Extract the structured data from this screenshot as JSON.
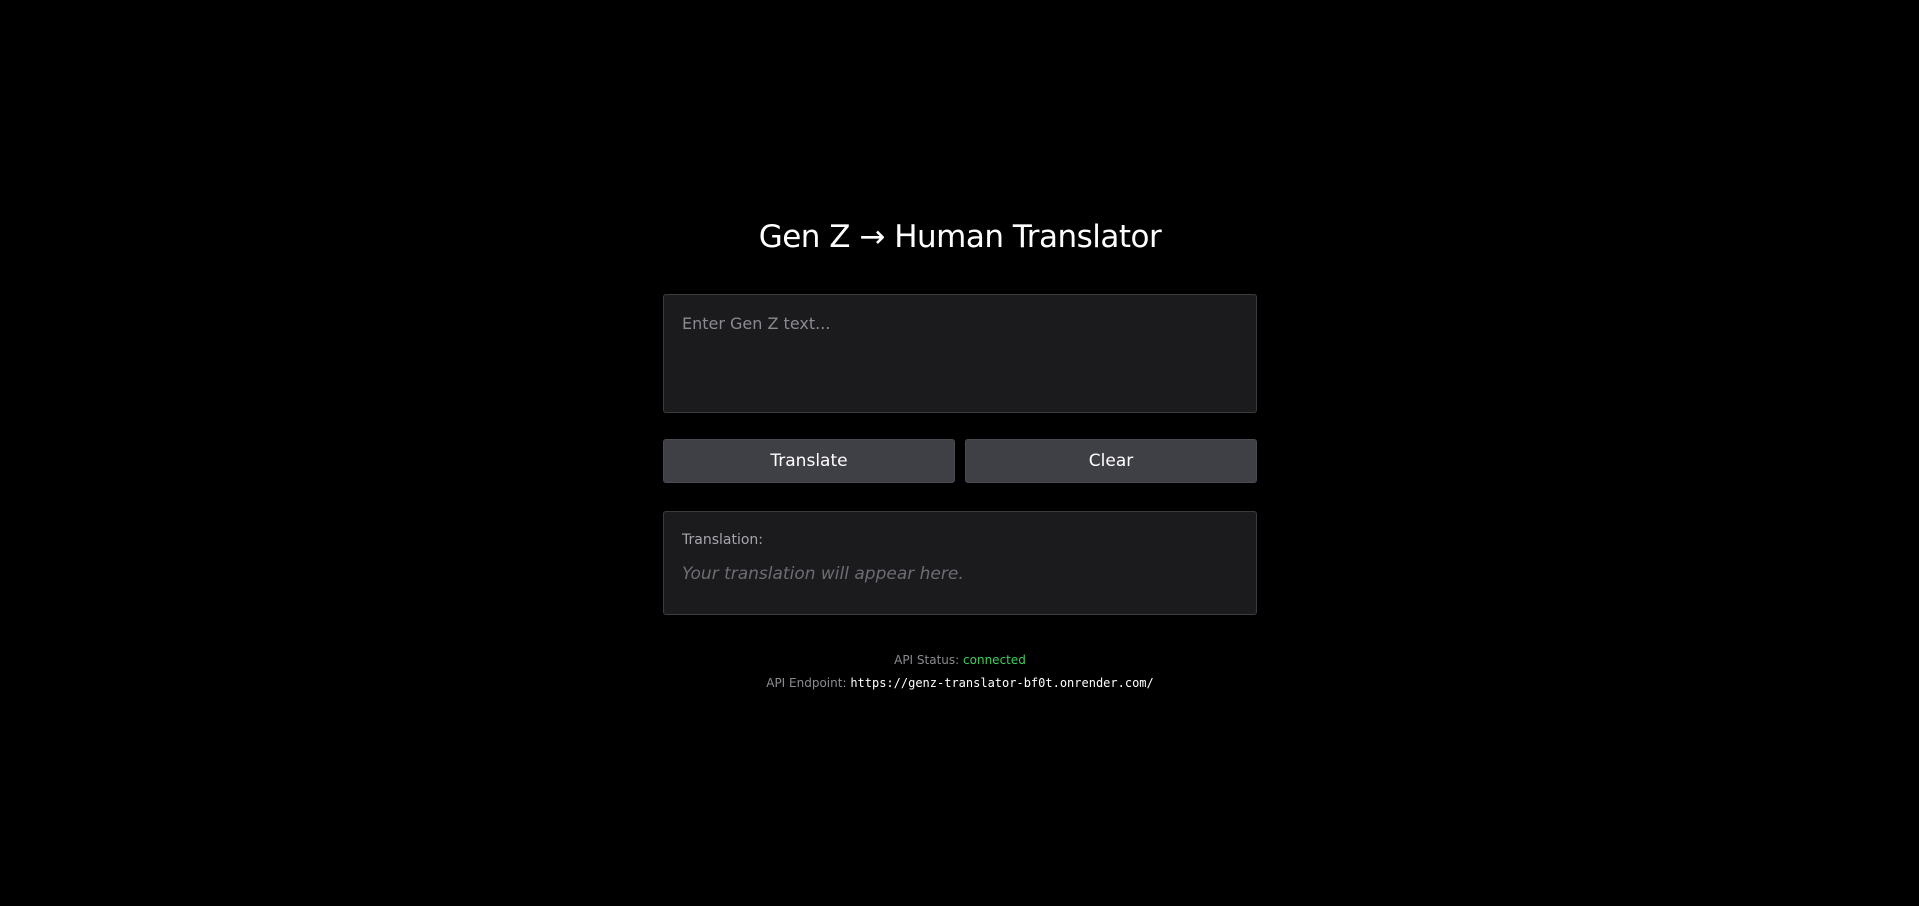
{
  "title": "Gen Z → Human Translator",
  "input": {
    "placeholder": "Enter Gen Z text...",
    "value": ""
  },
  "buttons": {
    "translate_label": "Translate",
    "clear_label": "Clear"
  },
  "output": {
    "label": "Translation:",
    "placeholder_text": "Your translation will appear here."
  },
  "api": {
    "status_label": "API Status:",
    "status_value": "connected",
    "endpoint_label": "API Endpoint:",
    "endpoint_value": "https://genz-translator-bf0t.onrender.com/"
  },
  "colors": {
    "background": "#000000",
    "panel": "#1b1b1e",
    "button": "#3f3f46",
    "status_ok": "#3ecf5a"
  }
}
